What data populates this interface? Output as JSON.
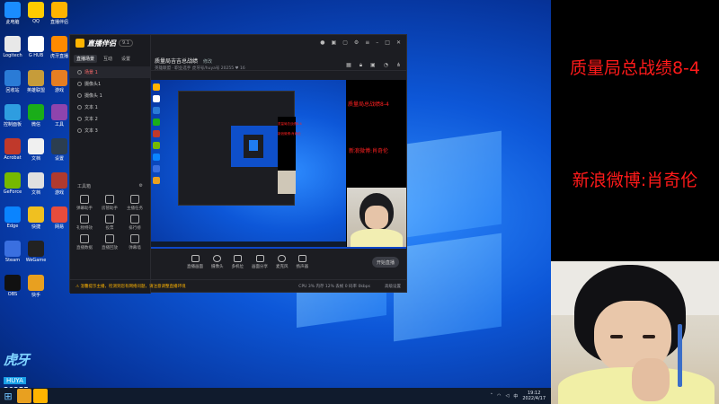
{
  "overlay": {
    "line1": "质量局总战绩8-4",
    "line2": "新浪微博:肖奇伦"
  },
  "app": {
    "name": "直播伴侣",
    "version": "9.1",
    "side_tabs": [
      "直播场景",
      "互动",
      "设置"
    ],
    "scenes": [
      "场景 1",
      "摄像头1",
      "摄像头 1",
      "文本 1",
      "文本 2",
      "文本 3"
    ],
    "tools_header": "工具箱",
    "tools": [
      "弹幕助手",
      "房管助手",
      "主播任务",
      "礼物特效",
      "投票",
      "排行榜",
      "直播数据",
      "直播回放",
      "弹幕墙"
    ],
    "room_title": "质量局吉吉总战绩",
    "room_title_btn": "修改",
    "room_sub": "英雄联盟 · 职业选手    虎牙号/huya号 20255  ♥ 16",
    "bottom_tools": [
      "直播画面",
      "摄像头",
      "多机位",
      "画面分享",
      "麦克风",
      "扬声器"
    ],
    "live_button": "开始直播",
    "status_warn": "⚠ 温馨提示主播，检测到您有网络问题，请注意调整直播环境",
    "status_right": "CPU 3%  内存 12%  丢帧 0  码率 0kbps",
    "status_end": "高级设置"
  },
  "hy": {
    "logo_a": "虎牙",
    "logo_b": "HUYA",
    "room_no": "20255"
  },
  "taskbar": {
    "time": "19:12",
    "date": "2022/4/17",
    "lang": "中"
  },
  "colors": {
    "accent_red": "#ff1a1a",
    "brand_yellow": "#ffb400"
  }
}
